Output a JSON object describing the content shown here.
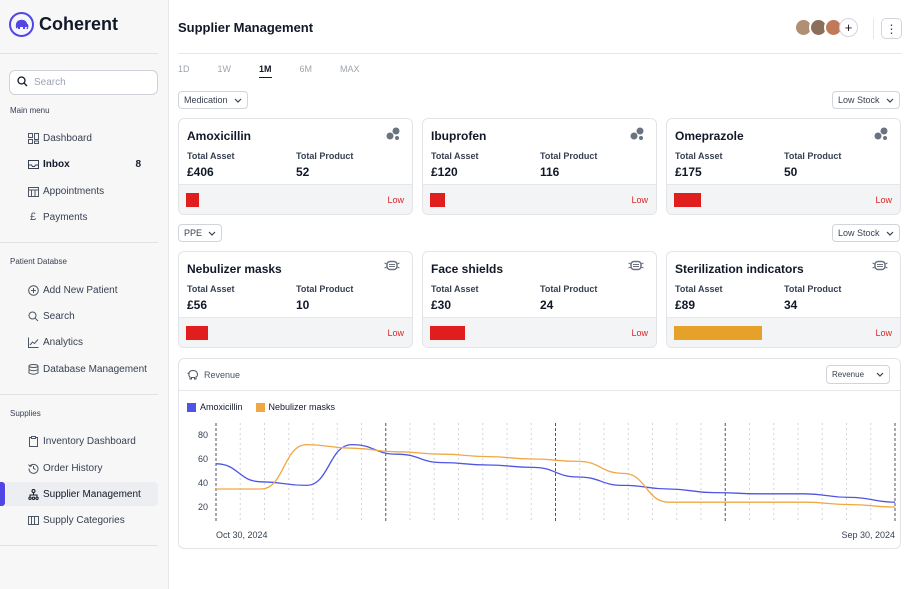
{
  "app": {
    "name": "Coherent"
  },
  "sidebar": {
    "search_placeholder": "Search",
    "sections": [
      {
        "label": "Main menu",
        "items": [
          {
            "label": "Dashboard",
            "icon": "dashboard-icon"
          },
          {
            "label": "Inbox",
            "icon": "inbox-icon",
            "count": "8"
          },
          {
            "label": "Appointments",
            "icon": "calendar-icon"
          },
          {
            "label": "Payments",
            "icon": "pound-icon"
          }
        ]
      },
      {
        "label": "Patient Databse",
        "items": [
          {
            "label": "Add New Patient",
            "icon": "add-circle-icon"
          },
          {
            "label": "Search",
            "icon": "search-icon"
          },
          {
            "label": "Analytics",
            "icon": "analytics-icon"
          },
          {
            "label": "Database Management",
            "icon": "database-icon"
          }
        ]
      },
      {
        "label": "Supplies",
        "items": [
          {
            "label": "Inventory Dashboard",
            "icon": "clipboard-icon"
          },
          {
            "label": "Order History",
            "icon": "history-icon"
          },
          {
            "label": "Supplier Management",
            "icon": "supplier-icon"
          },
          {
            "label": "Supply Categories",
            "icon": "categories-icon"
          }
        ]
      }
    ]
  },
  "header": {
    "title": "Supplier Management",
    "add_label": "+",
    "more_label": "⋮"
  },
  "timeframes": [
    "1D",
    "1W",
    "1M",
    "6M",
    "MAX"
  ],
  "active_timeframe": "1M",
  "groups": [
    {
      "filter": "Medication",
      "stock_filter": "Low Stock",
      "cards": [
        {
          "name": "Amoxicillin",
          "asset_label": "Total Asset",
          "asset": "£406",
          "product_label": "Total Product",
          "product": "52",
          "status": "Low",
          "level": 0.06,
          "bar_color": "#e11d1d"
        },
        {
          "name": "Ibuprofen",
          "asset_label": "Total Asset",
          "asset": "£120",
          "product_label": "Total Product",
          "product": "116",
          "status": "Low",
          "level": 0.07,
          "bar_color": "#e11d1d"
        },
        {
          "name": "Omeprazole",
          "asset_label": "Total Asset",
          "asset": "£175",
          "product_label": "Total Product",
          "product": "50",
          "status": "Low",
          "level": 0.12,
          "bar_color": "#e11d1d"
        }
      ]
    },
    {
      "filter": "PPE",
      "stock_filter": "Low Stock",
      "cards": [
        {
          "name": "Nebulizer masks",
          "asset_label": "Total Asset",
          "asset": "£56",
          "product_label": "Total Product",
          "product": "10",
          "status": "Low",
          "level": 0.1,
          "bar_color": "#e11d1d"
        },
        {
          "name": "Face shields",
          "asset_label": "Total Asset",
          "asset": "£30",
          "product_label": "Total Product",
          "product": "24",
          "status": "Low",
          "level": 0.16,
          "bar_color": "#e11d1d"
        },
        {
          "name": "Sterilization indicators",
          "asset_label": "Total Asset",
          "asset": "£89",
          "product_label": "Total Product",
          "product": "34",
          "status": "Low",
          "level": 0.4,
          "bar_color": "#e5a12a"
        }
      ]
    }
  ],
  "revenue": {
    "title": "Revenue",
    "dropdown": "Revenue"
  },
  "chart_data": {
    "type": "line",
    "x_labels": [
      "Oct 30, 2024",
      "Sep 30, 2024"
    ],
    "y_ticks": [
      80,
      60,
      40,
      20
    ],
    "ylim": [
      15,
      85
    ],
    "grid": "vertical dotted",
    "series": [
      {
        "name": "Amoxicillin",
        "color": "#4f55e3",
        "values": [
          56,
          41,
          38,
          72,
          64,
          57,
          55,
          53,
          45,
          38,
          35,
          32,
          31,
          31,
          28,
          24
        ]
      },
      {
        "name": "Nebulizer masks",
        "color": "#f0a845",
        "values": [
          35,
          35,
          72,
          69,
          66,
          64,
          62,
          60,
          58,
          48,
          24,
          24,
          24,
          24,
          22,
          20
        ]
      }
    ]
  },
  "colors": {
    "accent": "#4f46e5",
    "low": "#dc2626"
  }
}
